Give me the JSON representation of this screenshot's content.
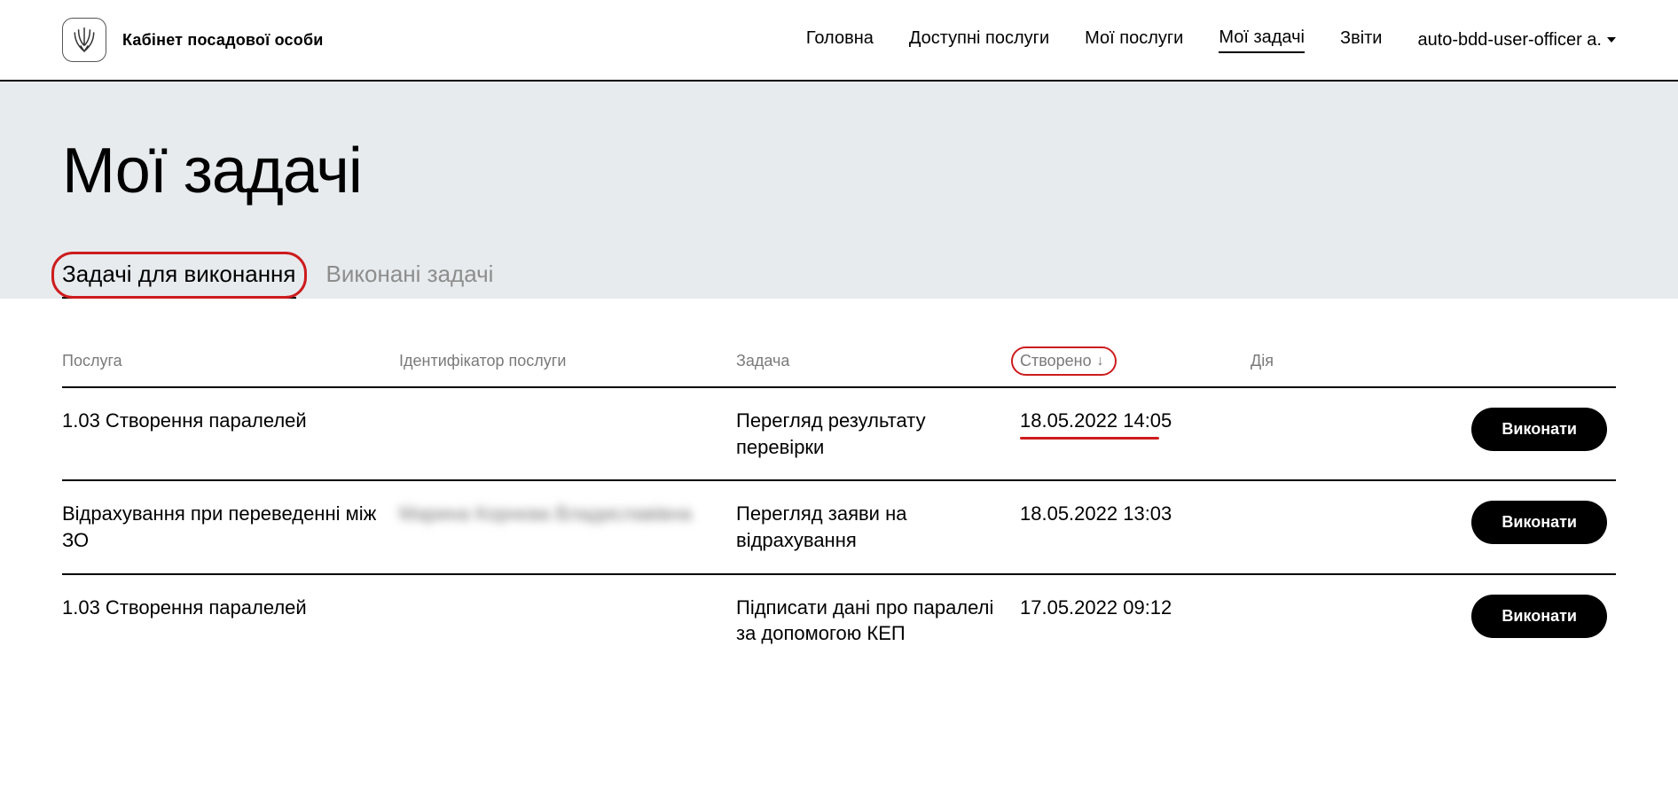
{
  "header": {
    "app_title": "Кабінет посадової особи",
    "nav": {
      "home": "Головна",
      "services": "Доступні послуги",
      "my_services": "Мої послуги",
      "my_tasks": "Мої задачі",
      "reports": "Звіти"
    },
    "user": "auto-bdd-user-officer а."
  },
  "page": {
    "title": "Мої задачі",
    "tabs": {
      "todo": "Задачі для виконання",
      "done": "Виконані задачі"
    }
  },
  "table": {
    "headers": {
      "service": "Послуга",
      "identifier": "Ідентифікатор послуги",
      "task": "Задача",
      "created": "Створено",
      "action": "Дія"
    },
    "action_label": "Виконати",
    "rows": [
      {
        "service": "1.03 Створення паралелей",
        "identifier": "",
        "task": "Перегляд результату перевірки",
        "created": "18.05.2022 14:05",
        "highlight_created": true
      },
      {
        "service": "Відрахування при переведенні між ЗО",
        "identifier": "Марина Корнєва Владиславівна",
        "identifier_blurred": true,
        "task": "Перегляд заяви на відрахування",
        "created": "18.05.2022 13:03"
      },
      {
        "service": "1.03 Створення паралелей",
        "identifier": "",
        "task": "Підписати дані про паралелі за допомогою КЕП",
        "created": "17.05.2022 09:12"
      }
    ]
  }
}
